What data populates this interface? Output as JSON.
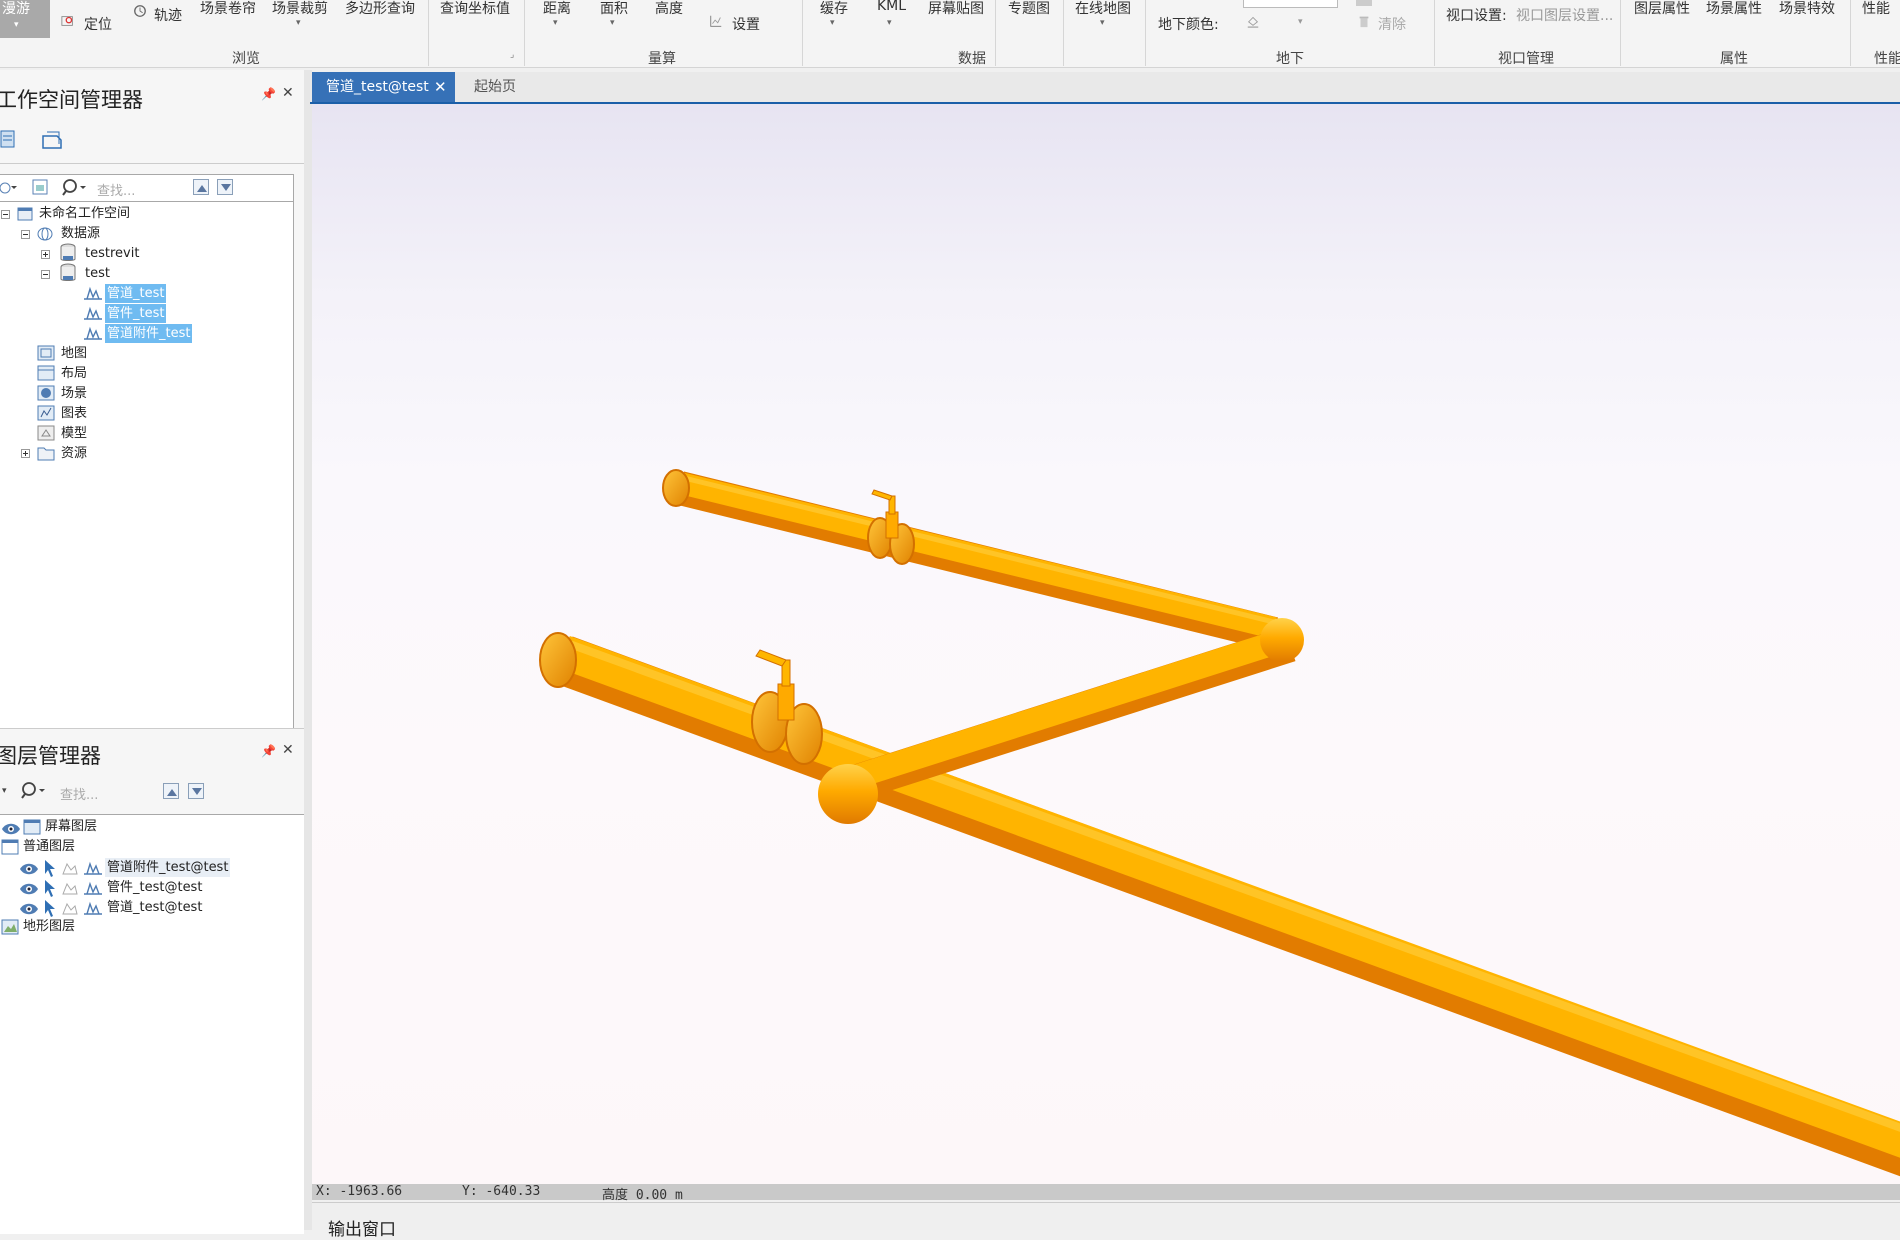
{
  "ribbon": {
    "row1": [
      "漫游",
      "定位",
      "轨迹",
      "场景卷帘",
      "场景裁剪",
      "多边形查询",
      "查询坐标值",
      "距离",
      "面积",
      "高度",
      "设置",
      "缓存",
      "KML",
      "屏幕贴图",
      "专题图",
      "在线地图",
      "地下颜色:",
      "清除",
      "视口设置:",
      "视口图层设置...",
      "图层属性",
      "场景属性",
      "场景特效",
      "性能"
    ],
    "groups": [
      "浏览",
      "量算",
      "数据",
      "地下",
      "视口管理",
      "属性",
      "性能"
    ]
  },
  "workspace_panel": {
    "title": "工作空间管理器",
    "search_placeholder": "查找...",
    "tree": {
      "root": "未命名工作空间",
      "datasource": "数据源",
      "ds1": "testrevit",
      "ds2": "test",
      "ds2_children": [
        "管道_test",
        "管件_test",
        "管道附件_test"
      ],
      "others": [
        "地图",
        "布局",
        "场景",
        "图表",
        "模型",
        "资源"
      ]
    }
  },
  "layer_panel": {
    "title": "图层管理器",
    "search_placeholder": "查找...",
    "screen_layer": "屏幕图层",
    "normal_layer": "普通图层",
    "layers": [
      "管道附件_test@test",
      "管件_test@test",
      "管道_test@test"
    ],
    "terrain_layer": "地形图层"
  },
  "tabs": {
    "active": "管道_test@test",
    "inactive": "起始页"
  },
  "statusbar": {
    "x": "X: -1963.66",
    "y": "Y: -640.33",
    "height": "高度 0.00 m"
  },
  "output": {
    "title": "输出窗口"
  },
  "colors": {
    "pipe": "#ffaa00",
    "accent": "#3671b7",
    "selection": "#6fbbf1"
  }
}
